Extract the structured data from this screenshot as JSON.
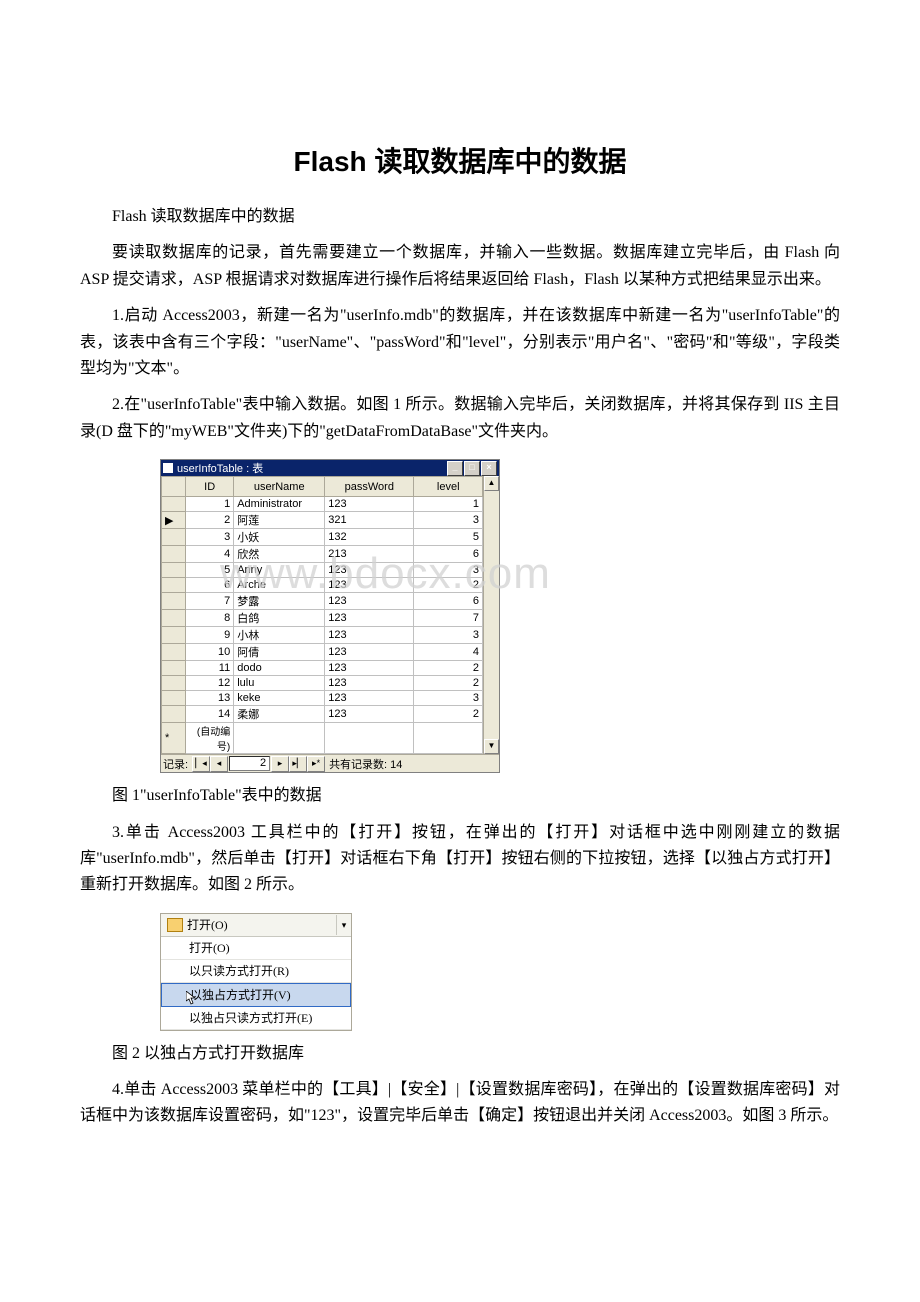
{
  "title": "Flash 读取数据库中的数据",
  "p1": "Flash 读取数据库中的数据",
  "p2": "要读取数据库的记录，首先需要建立一个数据库，并输入一些数据。数据库建立完毕后，由 Flash 向 ASP 提交请求，ASP 根据请求对数据库进行操作后将结果返回给 Flash，Flash 以某种方式把结果显示出来。",
  "p3": "1.启动 Access2003，新建一名为\"userInfo.mdb\"的数据库，并在该数据库中新建一名为\"userInfoTable\"的表，该表中含有三个字段：\"userName\"、\"passWord\"和\"level\"，分别表示\"用户名\"、\"密码\"和\"等级\"，字段类型均为\"文本\"。",
  "p4": "2.在\"userInfoTable\"表中输入数据。如图 1 所示。数据输入完毕后，关闭数据库，并将其保存到 IIS 主目录(D 盘下的\"myWEB\"文件夹)下的\"getDataFromDataBase\"文件夹内。",
  "cap1": "图 1\"userInfoTable\"表中的数据",
  "p5": "3.单击 Access2003 工具栏中的【打开】按钮，在弹出的【打开】对话框中选中刚刚建立的数据库\"userInfo.mdb\"，然后单击【打开】对话框右下角【打开】按钮右侧的下拉按钮，选择【以独占方式打开】重新打开数据库。如图 2 所示。",
  "cap2": "图 2 以独占方式打开数据库",
  "p6": "4.单击 Access2003 菜单栏中的【工具】|【安全】|【设置数据库密码】，在弹出的【设置数据库密码】对话框中为该数据库设置密码，如\"123\"，设置完毕后单击【确定】按钮退出并关闭 Access2003。如图 3 所示。",
  "win": {
    "title": "userInfoTable : 表",
    "minimize": "_",
    "maximize": "□",
    "close": "×",
    "headers": {
      "id": "ID",
      "user": "userName",
      "pass": "passWord",
      "level": "level"
    },
    "rows": [
      {
        "id": "1",
        "user": "Administrator",
        "pass": "123",
        "level": "1"
      },
      {
        "id": "2",
        "user": "阿莲",
        "pass": "321",
        "level": "3"
      },
      {
        "id": "3",
        "user": "小妖",
        "pass": "132",
        "level": "5"
      },
      {
        "id": "4",
        "user": "欣然",
        "pass": "213",
        "level": "6"
      },
      {
        "id": "5",
        "user": "Anny",
        "pass": "123",
        "level": "3"
      },
      {
        "id": "6",
        "user": "Arche",
        "pass": "123",
        "level": "2"
      },
      {
        "id": "7",
        "user": "梦露",
        "pass": "123",
        "level": "6"
      },
      {
        "id": "8",
        "user": "白鸽",
        "pass": "123",
        "level": "7"
      },
      {
        "id": "9",
        "user": "小林",
        "pass": "123",
        "level": "3"
      },
      {
        "id": "10",
        "user": "阿倩",
        "pass": "123",
        "level": "4"
      },
      {
        "id": "11",
        "user": "dodo",
        "pass": "123",
        "level": "2"
      },
      {
        "id": "12",
        "user": "lulu",
        "pass": "123",
        "level": "2"
      },
      {
        "id": "13",
        "user": "keke",
        "pass": "123",
        "level": "3"
      },
      {
        "id": "14",
        "user": "柔娜",
        "pass": "123",
        "level": "2"
      }
    ],
    "newRow": "(自动编号)",
    "navLabel": "记录:",
    "navCurrent": "2",
    "navTotal": "共有记录数: 14",
    "scrollUp": "▲",
    "scrollDown": "▼"
  },
  "menu": {
    "btn": "打开(O)",
    "dd": "▾",
    "items": [
      "打开(O)",
      "以只读方式打开(R)",
      "以独占方式打开(V)",
      "以独占只读方式打开(E)"
    ]
  },
  "watermark": "www.bdocx.com"
}
